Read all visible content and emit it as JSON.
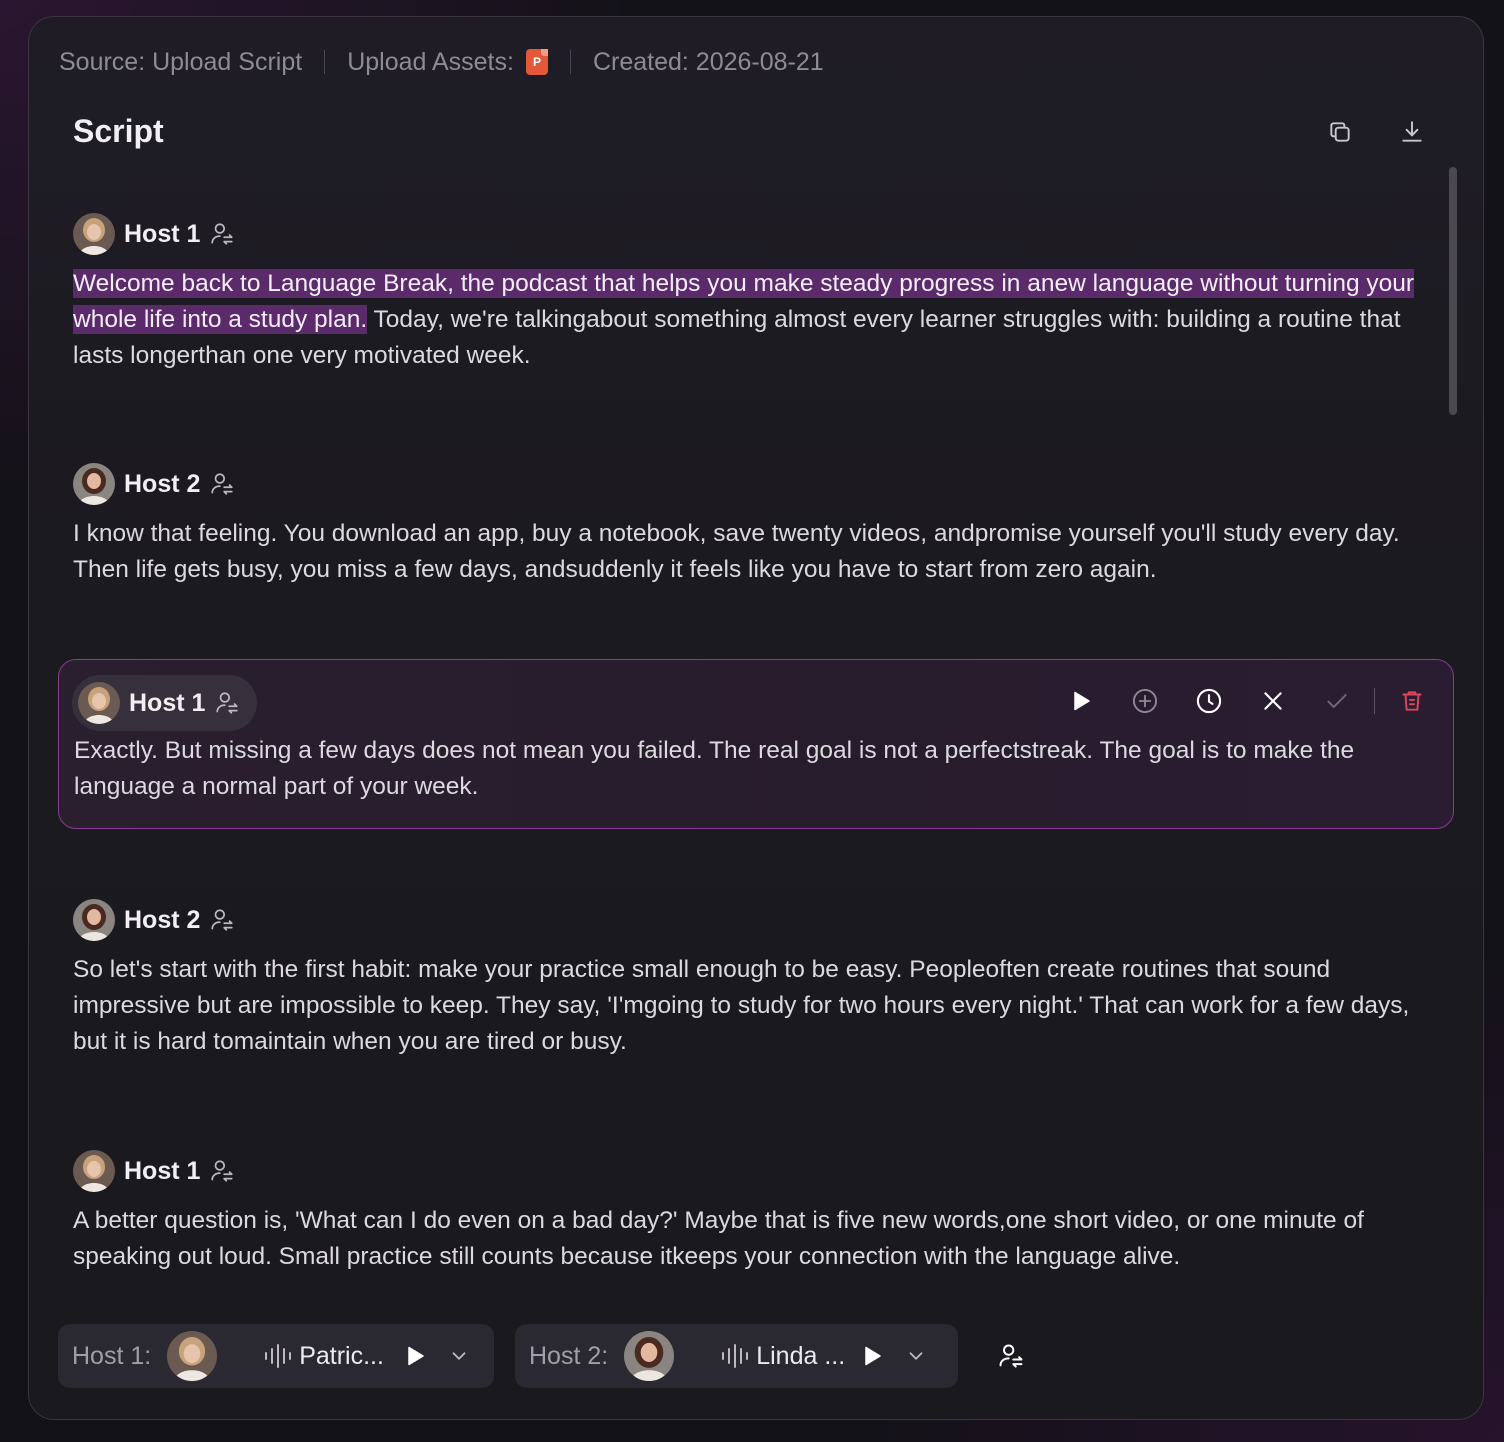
{
  "meta": {
    "source": "Source: Upload Script",
    "assets_label": "Upload Assets:",
    "asset_icon_letter": "P",
    "asset_icon_color": "#e4583a",
    "created": "Created: 2026-08-21"
  },
  "script": {
    "title": "Script",
    "copy_icon": "copy-icon",
    "download_icon": "download-icon"
  },
  "entries": [
    {
      "speaker": "Host 1",
      "highlighted_text": "Welcome back to Language Break, the podcast that helps you make steady progress in anew language without turning your whole life into a study plan.",
      "text": " Today, we're talkingabout something almost every learner struggles with: building a routine that lasts longerthan one very motivated week."
    },
    {
      "speaker": "Host 2",
      "text": "I know that feeling. You download an app, buy a notebook, save twenty videos, andpromise yourself you'll study every day. Then life gets busy, you miss a few days, andsuddenly it feels like you have to start from zero again."
    },
    {
      "speaker": "Host 1",
      "text": "Exactly. But missing a few days does not mean you failed. The real goal is not a perfectstreak. The goal is to make the language a normal part of your week.",
      "selected": true
    },
    {
      "speaker": "Host 2",
      "text": "So let's start with the first habit: make your practice small enough to be easy. Peopleoften create routines that sound impressive but are impossible to keep. They say, 'I'mgoing to study for two hours every night.' That can work for a few days, but it is hard tomaintain when you are tired or busy."
    },
    {
      "speaker": "Host 1",
      "text": "A better question is, 'What can I do even on a bad day?' Maybe that is five new words,one short video, or one minute of speaking out loud. Small practice still counts because itkeeps your connection with the language alive."
    }
  ],
  "selected_tools": [
    "play-icon",
    "add-circle-icon",
    "clock-icon",
    "close-icon",
    "check-icon",
    "trash-icon"
  ],
  "voices": {
    "host1_label": "Host 1:",
    "host1_voice": "Patric...",
    "host2_label": "Host 2:",
    "host2_voice": "Linda ..."
  },
  "colors": {
    "accent": "#8a3a95",
    "highlight": "#5a2a6a",
    "delete": "#e0445a"
  }
}
